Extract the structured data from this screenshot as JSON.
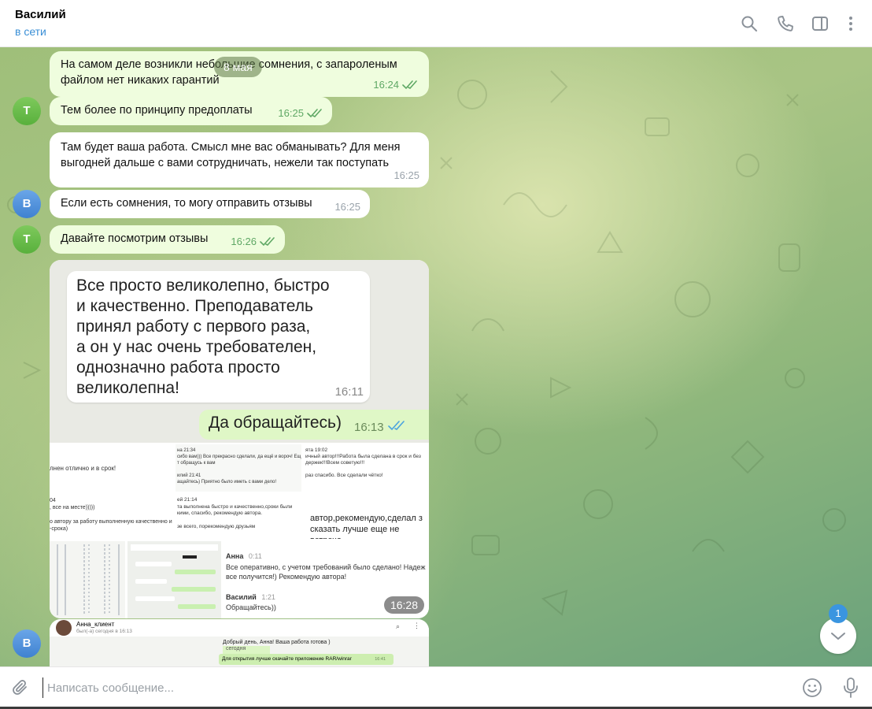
{
  "header": {
    "name": "Василий",
    "status": "в сети"
  },
  "date_pill": "8 мая",
  "messages": [
    {
      "text": "На самом деле возникли небольшие сомнения, с запароленым\nфайлом нет никаких гарантий",
      "time": "16:24",
      "direction": "out",
      "read": true
    },
    {
      "text": "Тем более по принципу предоплаты",
      "time": "16:25",
      "direction": "out",
      "read": true,
      "avatar": "Т"
    },
    {
      "text": "Там будет ваша работа. Смысл мне вас обманывать? Для меня\nвыгодней дальше с вами сотрудничать, нежели так поступать",
      "time": "16:25",
      "direction": "in"
    },
    {
      "text": "Если есть сомнения, то могу отправить отзывы",
      "time": "16:25",
      "direction": "in",
      "avatar": "В"
    },
    {
      "text": "Давайте посмотрим отзывы",
      "time": "16:26",
      "direction": "out",
      "read": true,
      "avatar": "Т"
    }
  ],
  "album": {
    "time": "16:28",
    "screenshot1": {
      "review": "Все просто великолепно, быстро\nи качественно. Преподаватель\nпринял работу с первого раза,\nа он у нас очень требователен,\nоднозначно работа просто\nвеликолепна!",
      "review_time": "16:11",
      "reply": "Да обращайтесь)",
      "reply_time": "16:13"
    },
    "tiles": [
      "лнен отлично и в срок!",
      "на 21:34\nсибо вам))) Все прекрасно сделали, да ещё и вороч! Ещ\nт обращусь к вам\n\nилий 21:41\nащайтесь) Приятно было иметь с вами дело!",
      "ята 19:02\nичный автор!!!Работа была сделана в срок и без\nдержек!!!Всем советую!!!\n\nраз спасибо. Все сделали чётко!",
      "04\n, все на месте)))))\n\nо автору за работу выполненную качественно и\n-срока)",
      "ей 21:14\nта выполнена быстро и качественно,сроки были\nкими, спасибо, рекомендую автора.\n\nзе всего, порекомендую друзьям",
      "автор,рекомендую,сделал з\nсказать лучше еще не встреча"
    ],
    "anna_tile": {
      "name1": "Анна",
      "time1": "0:11",
      "text1": "Все оперативно, с учетом требований было сделано! Надеж\nвсе получится!) Рекомендую автора!",
      "name2": "Василий",
      "time2": "1:21",
      "text2": "Обращайтесь))"
    }
  },
  "preview": {
    "name": "Анна_клиент",
    "status": "был(-а) сегодня в 16:13",
    "line1": "Добрый день, Анна! Ваша работа готова )",
    "today": "сегодня",
    "line2": "Для открытия лучше скачайте приложение RAR/winrar",
    "line2_time": "16:41",
    "avatar": "В"
  },
  "unread_count": "1",
  "composer": {
    "placeholder": "Написать сообщение..."
  },
  "icons": [
    "search-icon",
    "phone-icon",
    "sidebar-icon",
    "more-icon",
    "attach-icon",
    "emoji-icon",
    "mic-icon",
    "chevron-down-icon"
  ],
  "colors": {
    "accent": "#3a8fd6",
    "out_bubble": "#effdde",
    "in_bubble": "#ffffff",
    "out_time": "#5fa865",
    "badge": "#3a95e0"
  }
}
